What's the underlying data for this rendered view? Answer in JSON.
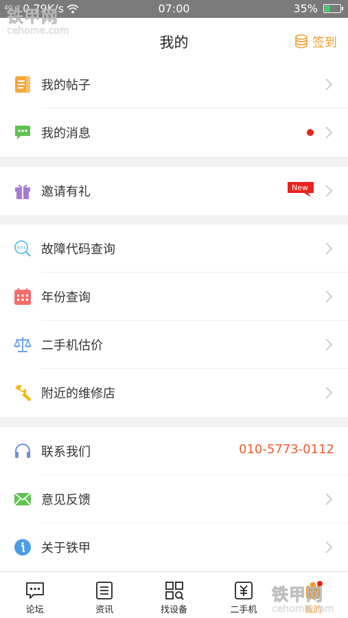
{
  "status_bar": {
    "network_speed": "0.79K/s",
    "signal_text": "4G ıll",
    "time": "07:00",
    "battery_percent": "35%",
    "battery_level": 0.35
  },
  "watermark": {
    "logo": "铁甲网",
    "domain": "cehome.com"
  },
  "header": {
    "title": "我的",
    "checkin_label": "签到"
  },
  "menu": {
    "my_posts": "我的帖子",
    "my_messages": "我的消息",
    "invite": "邀请有礼",
    "new_badge": "New",
    "fault_code": "故障代码查询",
    "year_query": "年份查询",
    "used_valuation": "二手机估价",
    "repair_shops": "附近的维修店",
    "contact_us": "联系我们",
    "phone": "010-5773-0112",
    "feedback": "意见反馈",
    "about": "关于铁甲"
  },
  "tabs": {
    "forum": "论坛",
    "news": "资讯",
    "find_equipment": "找设备",
    "used_machines": "二手机",
    "mine": "我的"
  },
  "colors": {
    "accent_orange": "#f39c2d",
    "phone_red": "#f25a2b",
    "dot_red": "#e8231c"
  }
}
